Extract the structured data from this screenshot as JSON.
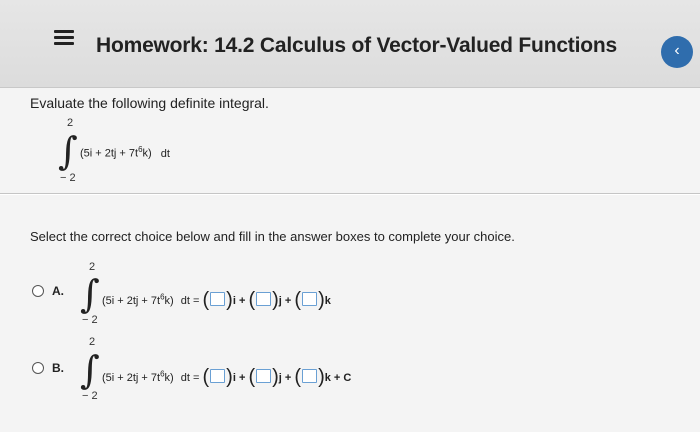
{
  "header": {
    "menu_icon": "hamburger-icon",
    "title": "Homework: 14.2 Calculus of Vector-Valued Functions",
    "back_icon": "chevron-left-icon",
    "back_glyph": "‹"
  },
  "question": {
    "prompt": "Evaluate the following definite integral.",
    "upper_limit": "2",
    "lower_limit": "− 2",
    "integrand_left": "(5i + 2tj + 7t",
    "integrand_exp": "6",
    "integrand_right": "k)",
    "differential": "dt"
  },
  "instruction": "Select the correct choice below and fill in the answer boxes to complete your choice.",
  "choices": [
    {
      "letter": "A.",
      "upper_limit": "2",
      "lower_limit": "− 2",
      "integrand": "(5i + 2tj + 7t",
      "exp": "6",
      "integrand_end": "k)",
      "lhs_tail": "dt =",
      "unit_i": "i +",
      "unit_j": "j +",
      "unit_k": "k",
      "constant": ""
    },
    {
      "letter": "B.",
      "upper_limit": "2",
      "lower_limit": "− 2",
      "integrand": "(5i + 2tj + 7t",
      "exp": "6",
      "integrand_end": "k)",
      "lhs_tail": "dt =",
      "unit_i": "i +",
      "unit_j": "j +",
      "unit_k": "k + C",
      "constant": ""
    }
  ]
}
